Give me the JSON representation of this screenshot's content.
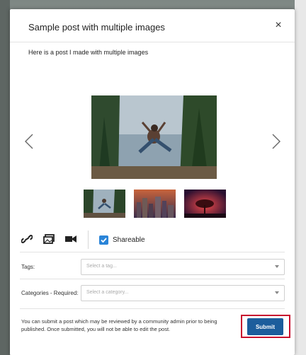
{
  "modal": {
    "title": "Sample post with multiple images",
    "close_label": "×",
    "post_text": "Here is a post I made with multiple images"
  },
  "carousel": {
    "prev_icon": "chevron-left-icon",
    "next_icon": "chevron-right-icon",
    "thumbnail_count": 3,
    "active_index": 0
  },
  "toolbar": {
    "icons": [
      "link-icon",
      "image-gallery-icon",
      "video-camera-icon"
    ],
    "shareable_label": "Shareable",
    "shareable_checked": true
  },
  "fields": {
    "tags": {
      "label": "Tags:",
      "placeholder": "Select a tag..."
    },
    "categories": {
      "label": "Categories - Required:",
      "placeholder": "Select a category..."
    }
  },
  "footer": {
    "notice": "You can submit a post which may be reviewed by a community admin prior to being published. Once submitted, you will not be able to edit the post.",
    "submit_label": "Submit"
  },
  "colors": {
    "submit": "#1c5d9c",
    "highlight_outline": "#c8102e",
    "checkbox": "#2a84d8"
  }
}
